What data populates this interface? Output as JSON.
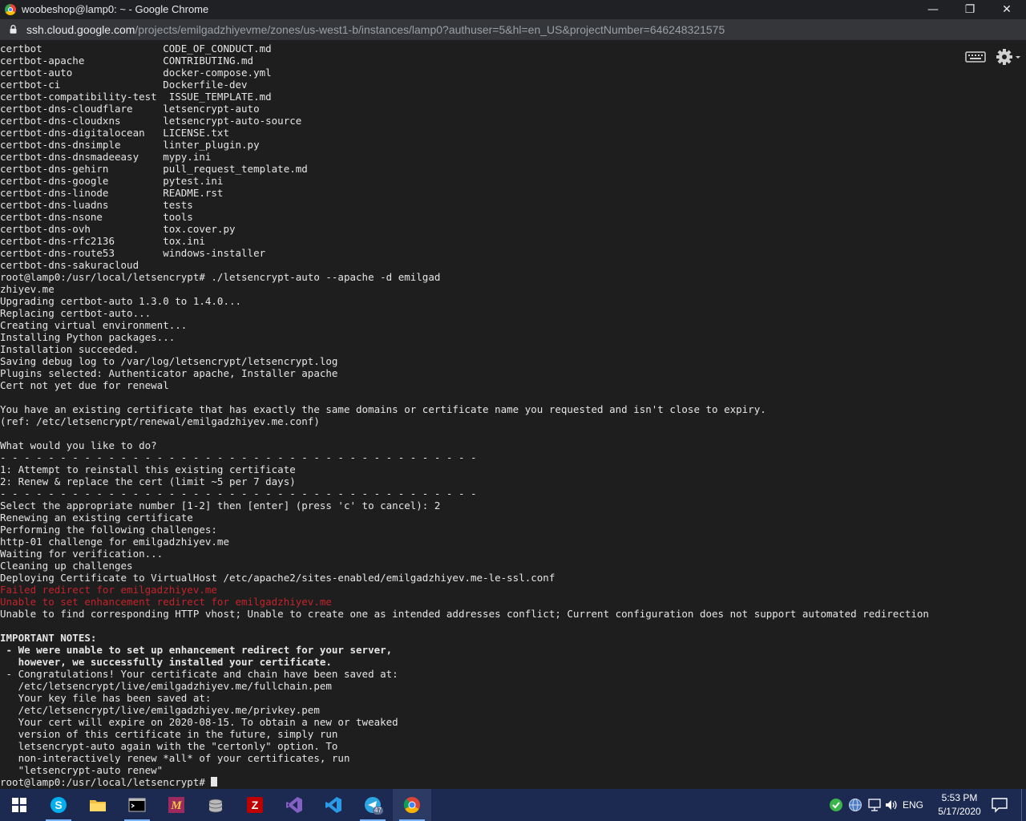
{
  "window": {
    "title": "woobeshop@lamp0: ~ - Google Chrome",
    "minimize_glyph": "—",
    "restore_glyph": "❐",
    "close_glyph": "✕"
  },
  "addressbar": {
    "host": "ssh.cloud.google.com",
    "path": "/projects/emilgadzhiyevme/zones/us-west1-b/instances/lamp0?authuser=5&hl=en_US&projectNumber=646248321575"
  },
  "terminal": {
    "lines": [
      {
        "text": "certbot                    CODE_OF_CONDUCT.md"
      },
      {
        "text": "certbot-apache             CONTRIBUTING.md"
      },
      {
        "text": "certbot-auto               docker-compose.yml"
      },
      {
        "text": "certbot-ci                 Dockerfile-dev"
      },
      {
        "text": "certbot-compatibility-test  ISSUE_TEMPLATE.md"
      },
      {
        "text": "certbot-dns-cloudflare     letsencrypt-auto"
      },
      {
        "text": "certbot-dns-cloudxns       letsencrypt-auto-source"
      },
      {
        "text": "certbot-dns-digitalocean   LICENSE.txt"
      },
      {
        "text": "certbot-dns-dnsimple       linter_plugin.py"
      },
      {
        "text": "certbot-dns-dnsmadeeasy    mypy.ini"
      },
      {
        "text": "certbot-dns-gehirn         pull_request_template.md"
      },
      {
        "text": "certbot-dns-google         pytest.ini"
      },
      {
        "text": "certbot-dns-linode         README.rst"
      },
      {
        "text": "certbot-dns-luadns         tests"
      },
      {
        "text": "certbot-dns-nsone          tools"
      },
      {
        "text": "certbot-dns-ovh            tox.cover.py"
      },
      {
        "text": "certbot-dns-rfc2136        tox.ini"
      },
      {
        "text": "certbot-dns-route53        windows-installer"
      },
      {
        "text": "certbot-dns-sakuracloud"
      },
      {
        "text": "root@lamp0:/usr/local/letsencrypt# ./letsencrypt-auto --apache -d emilgad"
      },
      {
        "text": "zhiyev.me"
      },
      {
        "text": "Upgrading certbot-auto 1.3.0 to 1.4.0..."
      },
      {
        "text": "Replacing certbot-auto..."
      },
      {
        "text": "Creating virtual environment..."
      },
      {
        "text": "Installing Python packages..."
      },
      {
        "text": "Installation succeeded."
      },
      {
        "text": "Saving debug log to /var/log/letsencrypt/letsencrypt.log"
      },
      {
        "text": "Plugins selected: Authenticator apache, Installer apache"
      },
      {
        "text": "Cert not yet due for renewal"
      },
      {
        "text": ""
      },
      {
        "text": "You have an existing certificate that has exactly the same domains or certificate name you requested and isn't close to expiry."
      },
      {
        "text": "(ref: /etc/letsencrypt/renewal/emilgadzhiyev.me.conf)"
      },
      {
        "text": ""
      },
      {
        "text": "What would you like to do?"
      },
      {
        "text": "- - - - - - - - - - - - - - - - - - - - - - - - - - - - - - - - - - - - - - - -"
      },
      {
        "text": "1: Attempt to reinstall this existing certificate"
      },
      {
        "text": "2: Renew & replace the cert (limit ~5 per 7 days)"
      },
      {
        "text": "- - - - - - - - - - - - - - - - - - - - - - - - - - - - - - - - - - - - - - - -"
      },
      {
        "text": "Select the appropriate number [1-2] then [enter] (press 'c' to cancel): 2"
      },
      {
        "text": "Renewing an existing certificate"
      },
      {
        "text": "Performing the following challenges:"
      },
      {
        "text": "http-01 challenge for emilgadzhiyev.me"
      },
      {
        "text": "Waiting for verification..."
      },
      {
        "text": "Cleaning up challenges"
      },
      {
        "text": "Deploying Certificate to VirtualHost /etc/apache2/sites-enabled/emilgadzhiyev.me-le-ssl.conf"
      },
      {
        "text": "Failed redirect for emilgadzhiyev.me",
        "style": "red"
      },
      {
        "text": "Unable to set enhancement redirect for emilgadzhiyev.me",
        "style": "red"
      },
      {
        "text": "Unable to find corresponding HTTP vhost; Unable to create one as intended addresses conflict; Current configuration does not support automated redirection"
      },
      {
        "text": ""
      },
      {
        "text": "IMPORTANT NOTES:",
        "style": "bold"
      },
      {
        "text": " - We were unable to set up enhancement redirect for your server,",
        "style": "bold"
      },
      {
        "text": "   however, we successfully installed your certificate.",
        "style": "bold"
      },
      {
        "text": " - Congratulations! Your certificate and chain have been saved at:"
      },
      {
        "text": "   /etc/letsencrypt/live/emilgadzhiyev.me/fullchain.pem"
      },
      {
        "text": "   Your key file has been saved at:"
      },
      {
        "text": "   /etc/letsencrypt/live/emilgadzhiyev.me/privkey.pem"
      },
      {
        "text": "   Your cert will expire on 2020-08-15. To obtain a new or tweaked"
      },
      {
        "text": "   version of this certificate in the future, simply run"
      },
      {
        "text": "   letsencrypt-auto again with the \"certonly\" option. To"
      },
      {
        "text": "   non-interactively renew *all* of your certificates, run"
      },
      {
        "text": "   \"letsencrypt-auto renew\""
      },
      {
        "text": "root@lamp0:/usr/local/letsencrypt# ",
        "cursor": true
      }
    ]
  },
  "taskbar": {
    "apps": [
      {
        "name": "windows-start",
        "icon": "windows-logo-icon"
      },
      {
        "name": "skype",
        "icon": "skype-icon"
      },
      {
        "name": "file-explorer",
        "icon": "folder-icon"
      },
      {
        "name": "terminal",
        "icon": "terminal-icon"
      },
      {
        "name": "mendeley",
        "icon": "mendeley-icon"
      },
      {
        "name": "database",
        "icon": "database-icon"
      },
      {
        "name": "filezilla",
        "icon": "filezilla-icon"
      },
      {
        "name": "visual-studio",
        "icon": "visual-studio-icon"
      },
      {
        "name": "vscode",
        "icon": "vscode-icon"
      },
      {
        "name": "telegram",
        "icon": "telegram-icon",
        "badge": "47"
      },
      {
        "name": "chrome",
        "icon": "chrome-icon"
      }
    ],
    "language": "ENG",
    "time": "5:53 PM",
    "date": "5/17/2020"
  },
  "colors": {
    "terminal_bg": "#1e1e1e",
    "terminal_fg": "#e6e6e6",
    "error_red": "#c4232b",
    "taskbar_bg": "#1c2a52"
  }
}
